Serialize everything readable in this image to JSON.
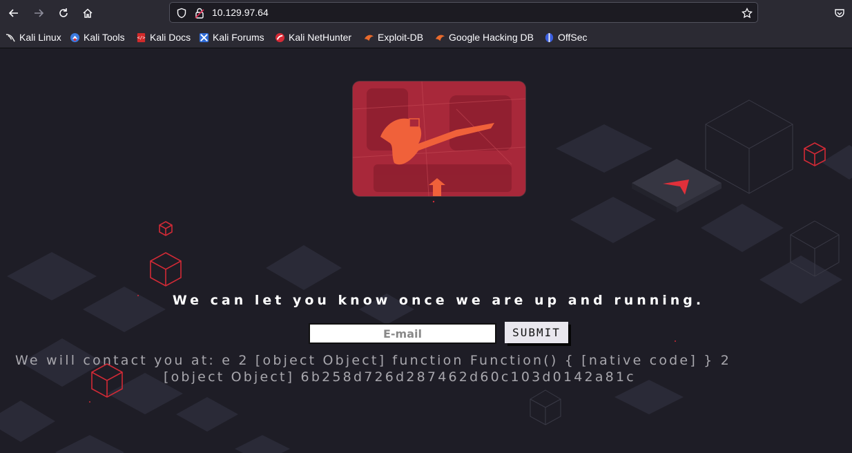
{
  "browser": {
    "url": "10.129.97.64",
    "bookmarks": [
      {
        "label": "Kali Linux",
        "icon": "kali-dragon-icon"
      },
      {
        "label": "Kali Tools",
        "icon": "kali-tools-icon"
      },
      {
        "label": "Kali Docs",
        "icon": "kali-docs-icon"
      },
      {
        "label": "Kali Forums",
        "icon": "kali-forums-icon"
      },
      {
        "label": "Kali NetHunter",
        "icon": "kali-nethunter-icon"
      },
      {
        "label": "Exploit-DB",
        "icon": "exploit-db-icon"
      },
      {
        "label": "Google Hacking DB",
        "icon": "google-hacking-db-icon"
      },
      {
        "label": "OffSec",
        "icon": "offsec-icon"
      }
    ]
  },
  "page": {
    "tagline": "We can let you know once we are up and running.",
    "email_placeholder": "E-mail",
    "submit_label": "SUBMIT",
    "contact_line1": "We will contact you at: e 2 [object Object] function Function() { [native code] } 2",
    "contact_line2": "[object Object] 6b258d726d287462d60c103d0142a81c"
  },
  "colors": {
    "background": "#1e1d26",
    "accent": "#e0303a",
    "hero": "#a8283a"
  }
}
